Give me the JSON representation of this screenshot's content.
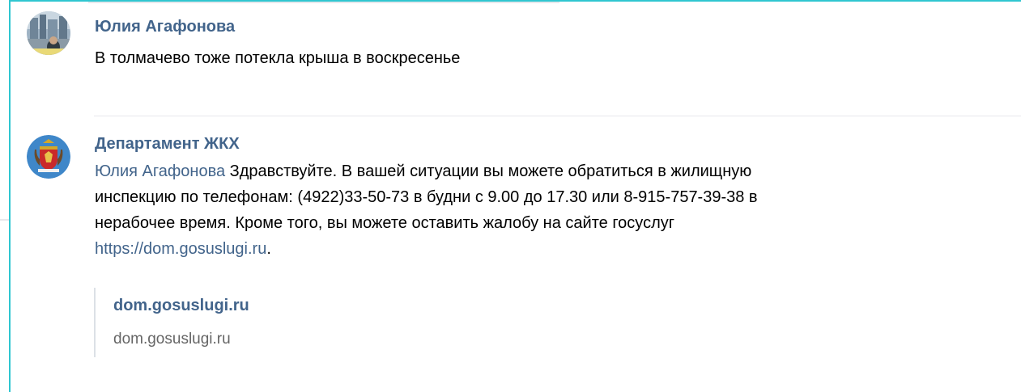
{
  "comments": [
    {
      "author": "Юлия Агафонова",
      "text": "В толмачево тоже потекла крыша в воскресенье",
      "avatar_icon": "user-photo-avatar"
    },
    {
      "author": "Департамент ЖКХ",
      "mention": "Юлия Агафонова",
      "text_line1": " Здравствуйте. В вашей ситуации вы можете обратиться в жилищную",
      "text_line2": "инспекцию по телефонам: (4922)33-50-73 в будни с 9.00 до 17.30 или 8-915-757-39-38 в",
      "text_line3": "нерабочее время. Кроме того, вы можете оставить жалобу на сайте госуслуг",
      "link": "https://dom.gosuslugi.ru",
      "link_suffix": ".",
      "avatar_icon": "coat-of-arms-avatar",
      "snippet": {
        "title": "dom.gosuslugi.ru",
        "domain": "dom.gosuslugi.ru"
      }
    }
  ],
  "colors": {
    "accent_border": "#2fc6d0",
    "author_link": "#42648b",
    "divider": "#e7e8ec"
  }
}
